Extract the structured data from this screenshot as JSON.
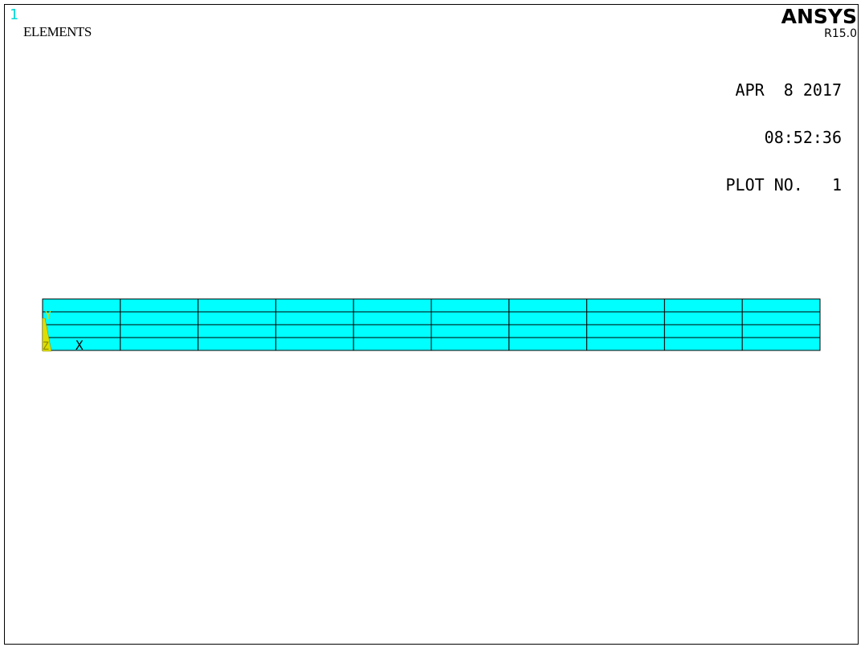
{
  "window_number": "1",
  "title": "ELEMENTS",
  "logo": "ANSYS",
  "release": "R15.0",
  "info": {
    "date": "APR  8 2017",
    "time": "08:52:36",
    "plot_no": "PLOT NO.   1"
  },
  "triad": {
    "y_label": "Y",
    "z_label": "Z",
    "x_label": "X"
  },
  "mesh": {
    "columns": 10,
    "rows": 4,
    "fill_color": "#00ffff",
    "line_color": "#000000"
  },
  "colors": {
    "window_number": "#00d8d8",
    "triad": "#dddd00"
  }
}
